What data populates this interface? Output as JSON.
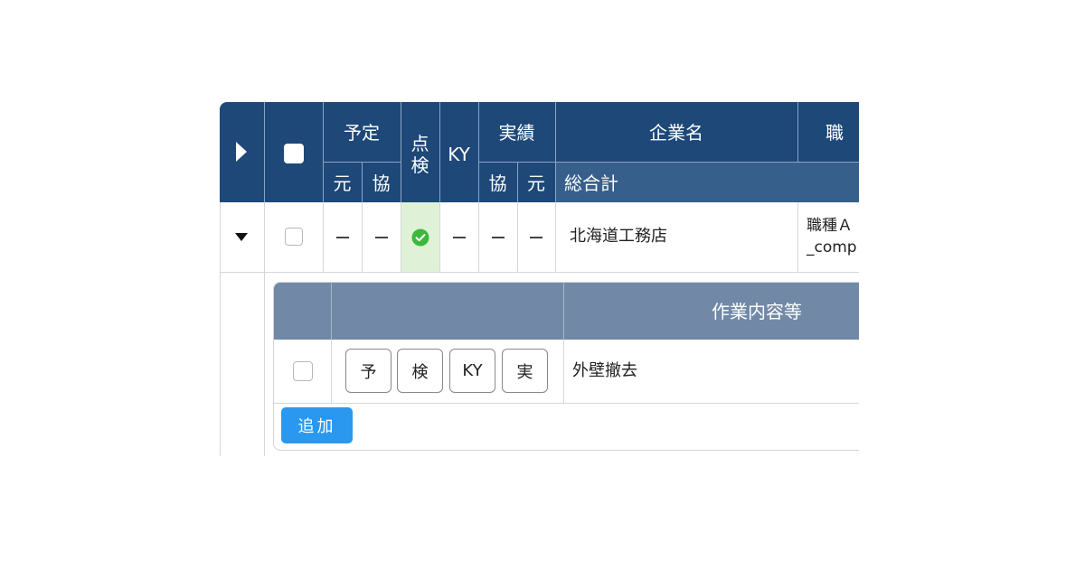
{
  "header": {
    "yotei": "予定",
    "tenken": "点\n検",
    "ky": "KY",
    "jisseki": "実績",
    "company": "企業名",
    "trade_partial": "職",
    "moto": "元",
    "kyo": "協",
    "total": "総合計"
  },
  "row": {
    "company_name": "北海道工務店",
    "trade_line1": "職種Ａ",
    "trade_line2": "_comp"
  },
  "subtable": {
    "header_work": "作業内容等",
    "buttons": [
      "予",
      "検",
      "KY",
      "実"
    ],
    "work": "外壁撤去",
    "add_label": "追加"
  },
  "colors": {
    "header": "#1d4878",
    "subheader": "#365f8b",
    "inner_header": "#7189a7",
    "ok_green": "#3db83d",
    "check_bg": "#dff2d8",
    "add_button": "#2a98ef"
  }
}
